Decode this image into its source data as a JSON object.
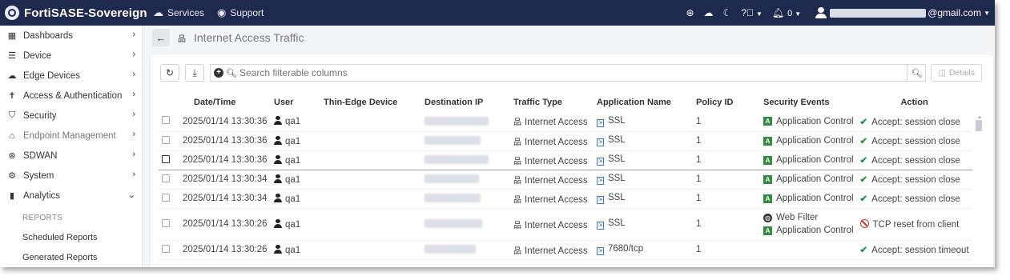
{
  "topbar": {
    "brand": "FortiSASE-Sovereign",
    "services": "Services",
    "support": "Support",
    "notifications_count": "0",
    "user_email_suffix": "@gmail.com"
  },
  "sidebar": {
    "items": [
      {
        "label": "Dashboards",
        "icon": "grid-icon"
      },
      {
        "label": "Device",
        "icon": "list-icon"
      },
      {
        "label": "Edge Devices",
        "icon": "cloud-icon"
      },
      {
        "label": "Access & Authentication",
        "icon": "person-icon"
      },
      {
        "label": "Security",
        "icon": "shield-icon"
      },
      {
        "label": "Endpoint Management",
        "icon": "endpoint-icon"
      },
      {
        "label": "SDWAN",
        "icon": "sdwan-icon"
      },
      {
        "label": "System",
        "icon": "gear-icon"
      },
      {
        "label": "Analytics",
        "icon": "chart-icon"
      }
    ],
    "section": "REPORTS",
    "sub_items": [
      "Scheduled Reports",
      "Generated Reports"
    ]
  },
  "page": {
    "title": "Internet Access Traffic"
  },
  "toolbar": {
    "search_placeholder": "Search filterable columns",
    "details_label": "Details"
  },
  "table": {
    "columns": [
      "Date/Time",
      "User",
      "Thin-Edge Device",
      "Destination IP",
      "Traffic Type",
      "Application Name",
      "Policy ID",
      "Security Events",
      "Action"
    ],
    "rows": [
      {
        "datetime": "2025/01/14 13:30:36",
        "user": "qa1",
        "traffic": "Internet Access",
        "app": "SSL",
        "policy": "1",
        "events": [
          "Application Control"
        ],
        "action": "Accept: session close",
        "action_type": "accept"
      },
      {
        "datetime": "2025/01/14 13:30:36",
        "user": "qa1",
        "traffic": "Internet Access",
        "app": "SSL",
        "policy": "1",
        "events": [
          "Application Control"
        ],
        "action": "Accept: session close",
        "action_type": "accept"
      },
      {
        "datetime": "2025/01/14 13:30:36",
        "user": "qa1",
        "traffic": "Internet Access",
        "app": "SSL",
        "policy": "1",
        "events": [
          "Application Control"
        ],
        "action": "Accept: session close",
        "action_type": "accept"
      },
      {
        "datetime": "2025/01/14 13:30:34",
        "user": "qa1",
        "traffic": "Internet Access",
        "app": "SSL",
        "policy": "1",
        "events": [
          "Application Control"
        ],
        "action": "Accept: session close",
        "action_type": "accept"
      },
      {
        "datetime": "2025/01/14 13:30:34",
        "user": "qa1",
        "traffic": "Internet Access",
        "app": "SSL",
        "policy": "1",
        "events": [
          "Application Control"
        ],
        "action": "Accept: session close",
        "action_type": "accept"
      },
      {
        "datetime": "2025/01/14 13:30:26",
        "user": "qa1",
        "traffic": "Internet Access",
        "app": "SSL",
        "policy": "1",
        "events": [
          "Web Filter",
          "Application Control"
        ],
        "action": "TCP reset from client",
        "action_type": "reset"
      },
      {
        "datetime": "2025/01/14 13:30:26",
        "user": "qa1",
        "traffic": "Internet Access",
        "app": "7680/tcp",
        "policy": "1",
        "events": [],
        "action": "Accept: session timeout",
        "action_type": "accept"
      }
    ]
  },
  "colors": {
    "topbar_bg": "#1d2a4d",
    "accept_green": "#2e8b3f",
    "reset_red": "#c0392b"
  }
}
